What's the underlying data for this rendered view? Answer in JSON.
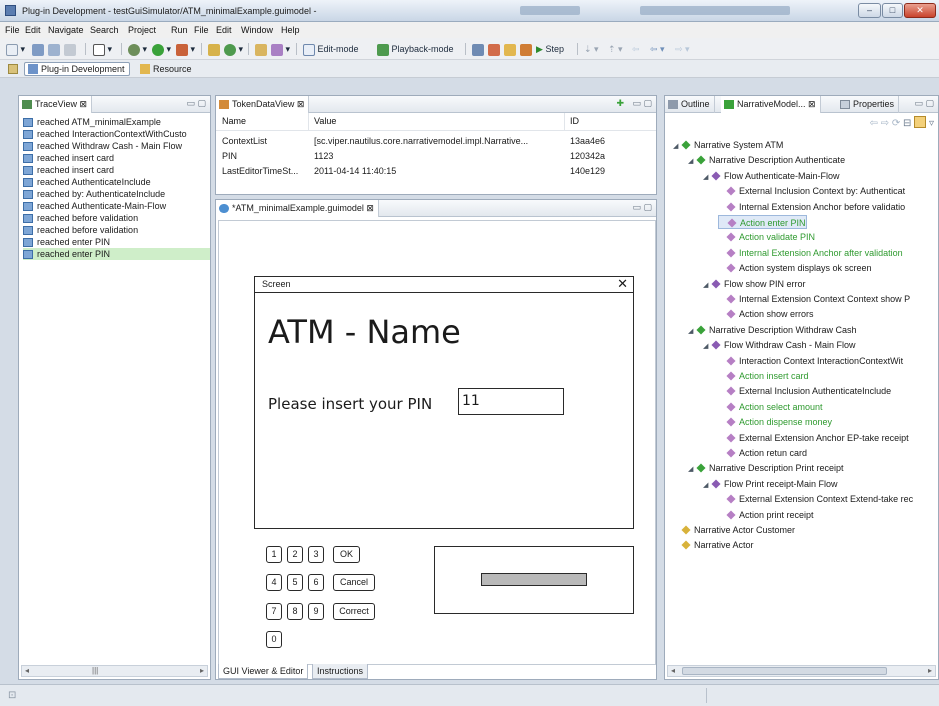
{
  "window": {
    "title": "Plug-in Development - testGuiSimulator/ATM_minimalExample.guimodel -",
    "controls": [
      "minimize",
      "maximize",
      "close"
    ]
  },
  "menu": [
    "File",
    "Edit",
    "Navigate",
    "Search",
    "Project",
    "Run",
    "File",
    "Edit",
    "Window",
    "Help"
  ],
  "toolbar": {
    "edit_mode": "Edit-mode",
    "playback_mode": "Playback-mode",
    "step": "Step"
  },
  "perspectives": {
    "plugin_dev": "Plug-in Development",
    "resource": "Resource"
  },
  "trace_view": {
    "tab": "TraceView",
    "items": [
      "reached ATM_minimalExample",
      "reached InteractionContextWithCusto",
      "reached Withdraw Cash - Main Flow",
      "reached insert card",
      "reached insert card",
      "reached AuthenticateInclude",
      "reached by: AuthenticateInclude",
      "reached Authenticate-Main-Flow",
      "reached before validation",
      "reached before validation",
      "reached enter PIN",
      "reached enter PIN"
    ],
    "selected_index": 11
  },
  "token_view": {
    "tab": "TokenDataView",
    "columns": [
      "Name",
      "Value",
      "ID"
    ],
    "rows": [
      [
        "ContextList",
        "[sc.viper.nautilus.core.narrativemodel.impl.Narrative...",
        "13aa4e6"
      ],
      [
        "PIN",
        "1123",
        "120342a"
      ],
      [
        "LastEditorTimeSt...",
        "2011-04-14 11:40:15",
        "140e129"
      ]
    ]
  },
  "editor": {
    "tab": "*ATM_minimalExample.guimodel",
    "screen_label": "Screen",
    "close_glyph": "✕",
    "heading": "ATM - Name",
    "prompt": "Please insert your PIN",
    "pin_value": "11",
    "keys": [
      "1",
      "2",
      "3",
      "OK",
      "4",
      "5",
      "6",
      "Cancel",
      "7",
      "8",
      "9",
      "Correct",
      "0"
    ],
    "bottom_tabs": [
      "GUI Viewer & Editor",
      "Instructions"
    ]
  },
  "outline": {
    "tabs": [
      "Outline",
      "NarrativeModel...",
      "Properties"
    ],
    "items": [
      {
        "label": "Narrative System ATM",
        "depth": 0,
        "kind": "green-node",
        "color": "normal"
      },
      {
        "label": "Narrative Description Authenticate",
        "depth": 1,
        "kind": "green-node",
        "color": "normal"
      },
      {
        "label": "Flow Authenticate-Main-Flow",
        "depth": 2,
        "kind": "purple-node",
        "color": "normal"
      },
      {
        "label": "External Inclusion Context by: Authenticat",
        "depth": 3,
        "kind": "leaf",
        "color": "normal"
      },
      {
        "label": "Internal Extension Anchor before validatio",
        "depth": 3,
        "kind": "leaf",
        "color": "normal"
      },
      {
        "label": "Action enter PIN",
        "depth": 3,
        "kind": "leaf",
        "color": "green",
        "selected": true
      },
      {
        "label": "Action validate PIN",
        "depth": 3,
        "kind": "leaf",
        "color": "green"
      },
      {
        "label": "Internal Extension Anchor after validation",
        "depth": 3,
        "kind": "leaf",
        "color": "green"
      },
      {
        "label": "Action system displays ok screen",
        "depth": 3,
        "kind": "leaf",
        "color": "normal"
      },
      {
        "label": "Flow show PIN error",
        "depth": 2,
        "kind": "purple-node",
        "color": "normal"
      },
      {
        "label": "Internal Extension Context Context show P",
        "depth": 3,
        "kind": "leaf",
        "color": "normal"
      },
      {
        "label": "Action show errors",
        "depth": 3,
        "kind": "leaf",
        "color": "normal"
      },
      {
        "label": "Narrative Description Withdraw Cash",
        "depth": 1,
        "kind": "green-node",
        "color": "normal"
      },
      {
        "label": "Flow Withdraw Cash - Main Flow",
        "depth": 2,
        "kind": "purple-node",
        "color": "normal"
      },
      {
        "label": "Interaction Context InteractionContextWit",
        "depth": 3,
        "kind": "leaf",
        "color": "normal"
      },
      {
        "label": "Action insert card",
        "depth": 3,
        "kind": "leaf",
        "color": "green"
      },
      {
        "label": "External Inclusion AuthenticateInclude",
        "depth": 3,
        "kind": "leaf",
        "color": "normal"
      },
      {
        "label": "Action select amount",
        "depth": 3,
        "kind": "leaf",
        "color": "green"
      },
      {
        "label": "Action dispense money",
        "depth": 3,
        "kind": "leaf",
        "color": "green"
      },
      {
        "label": "External Extension Anchor EP-take receipt",
        "depth": 3,
        "kind": "leaf",
        "color": "normal"
      },
      {
        "label": "Action retun card",
        "depth": 3,
        "kind": "leaf",
        "color": "normal"
      },
      {
        "label": "Narrative Description Print receipt",
        "depth": 1,
        "kind": "green-node",
        "color": "normal"
      },
      {
        "label": "Flow Print receipt-Main Flow",
        "depth": 2,
        "kind": "purple-node",
        "color": "normal"
      },
      {
        "label": "External Extension Context Extend-take rec",
        "depth": 3,
        "kind": "leaf",
        "color": "normal"
      },
      {
        "label": "Action print receipt",
        "depth": 3,
        "kind": "leaf",
        "color": "normal"
      },
      {
        "label": "Narrative Actor Customer",
        "depth": 0,
        "kind": "yellow-node",
        "color": "normal"
      },
      {
        "label": "Narrative Actor",
        "depth": 0,
        "kind": "yellow-node",
        "color": "normal"
      }
    ]
  },
  "colors": {
    "selected_trace": "#cfeec9",
    "green_text": "#2f9a2f",
    "accent": "#5b7db0"
  }
}
